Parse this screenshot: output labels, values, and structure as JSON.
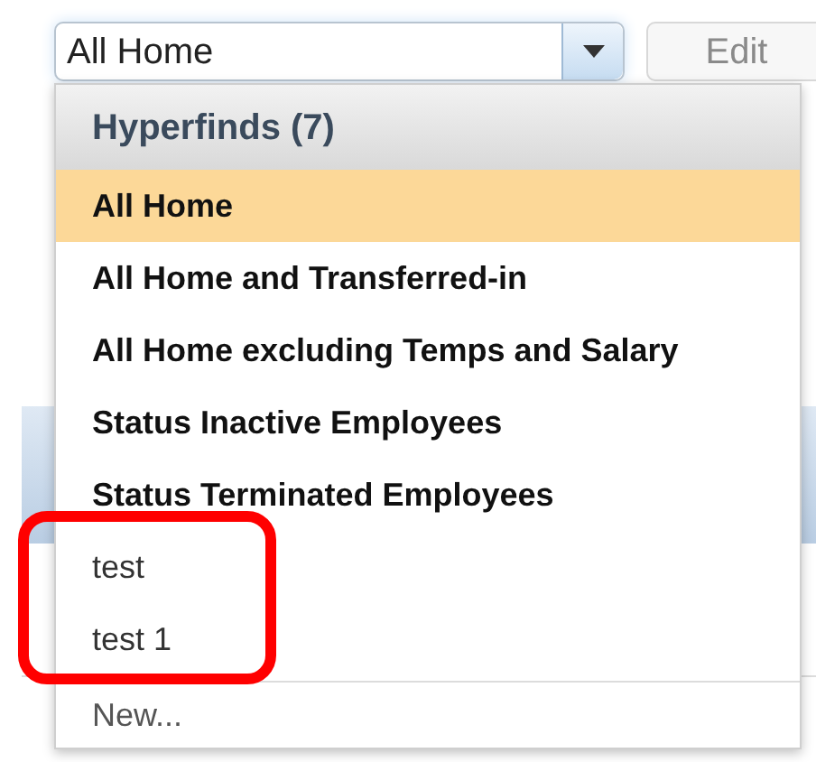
{
  "select": {
    "value": "All Home",
    "expanded": true
  },
  "edit_button": {
    "label": "Edit",
    "disabled": true
  },
  "dropdown": {
    "header": "Hyperfinds (7)",
    "items": [
      {
        "label": "All Home",
        "kind": "bold",
        "selected": true
      },
      {
        "label": "All Home and Transferred-in",
        "kind": "bold",
        "selected": false
      },
      {
        "label": "All Home excluding Temps and Salary",
        "kind": "bold",
        "selected": false
      },
      {
        "label": "Status Inactive Employees",
        "kind": "bold",
        "selected": false
      },
      {
        "label": "Status Terminated Employees",
        "kind": "bold",
        "selected": false
      },
      {
        "label": "test",
        "kind": "plain",
        "selected": false
      },
      {
        "label": "test 1",
        "kind": "plain",
        "selected": false
      }
    ],
    "footer": "New..."
  }
}
